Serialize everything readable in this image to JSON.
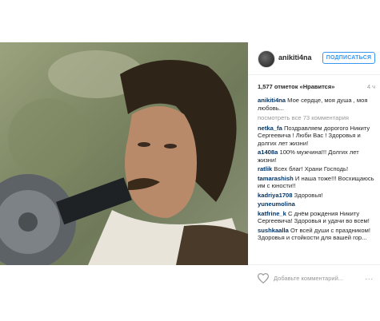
{
  "post": {
    "username": "anikiti4na",
    "follow_label": "ПОДПИСАТЬСЯ",
    "likes": "1,577 отметок «Нравится»",
    "time": "4 ч",
    "view_all": "посмотреть все 73 комментария",
    "comments": [
      {
        "user": "anikiti4na",
        "text": "Мое сердце, моя душа , моя любовь..."
      },
      {
        "user": "netka_fa",
        "text": "Поздравляем дорогого Никиту Сергеевича ! Люби Вас ! Здоровья и долгих лет жизни!"
      },
      {
        "user": "a1408a",
        "text": "100% мужчина!!! Долгих лет жизни!"
      },
      {
        "user": "ratlik",
        "text": "Всех благ! Храни Господь!"
      },
      {
        "user": "tamarashish",
        "text": "И наша тоже!!! Восхищаюсь им с юности!!"
      },
      {
        "user": "kadriya1708",
        "text": "Здоровья!"
      },
      {
        "user": "yuneumolina",
        "text": ""
      },
      {
        "user": "katfrine_k",
        "text": "С днём рождения Никиту Сергеевича! Здоровья и удачи во всем!"
      },
      {
        "user": "sushkaalla",
        "text": "От всей души с праздником! Здоровья и стойкости для вашей гор..."
      }
    ],
    "add_comment_placeholder": "Добавьте комментарий...",
    "more_label": "..."
  }
}
